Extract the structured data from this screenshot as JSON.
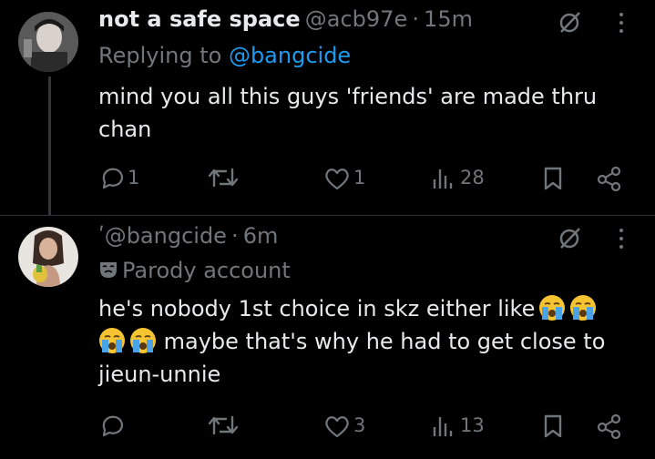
{
  "tweet1": {
    "display_name": "not a safe space",
    "handle": "@acb97e",
    "sep": "·",
    "time": "15m",
    "replying_prefix": "Replying to ",
    "replying_handle": "@bangcide",
    "body_line1": "mind you all this guys 'friends' are made thru",
    "body_line2": "chan",
    "reply_count": "1",
    "like_count": "1",
    "views_count": "28"
  },
  "tweet2": {
    "handle_mark": "ʹ",
    "handle": "@bangcide",
    "sep": "·",
    "time": "6m",
    "parody_label": "Parody account",
    "body_line1": "he's nobody 1st choice in skz either like",
    "body_line2": "maybe that's why he had to get close to",
    "body_line3": "jieun-unnie",
    "like_count": "3",
    "views_count": "13"
  },
  "colors": {
    "background": "#000000",
    "text": "#e7e9ea",
    "muted": "#71767b",
    "link": "#1d9bf0"
  },
  "icons": [
    "grok-slash-icon",
    "more-icon",
    "reply-icon",
    "retweet-icon",
    "like-icon",
    "views-icon",
    "bookmark-icon",
    "share-icon",
    "parody-mask-icon",
    "loudly-crying-face-icon"
  ]
}
